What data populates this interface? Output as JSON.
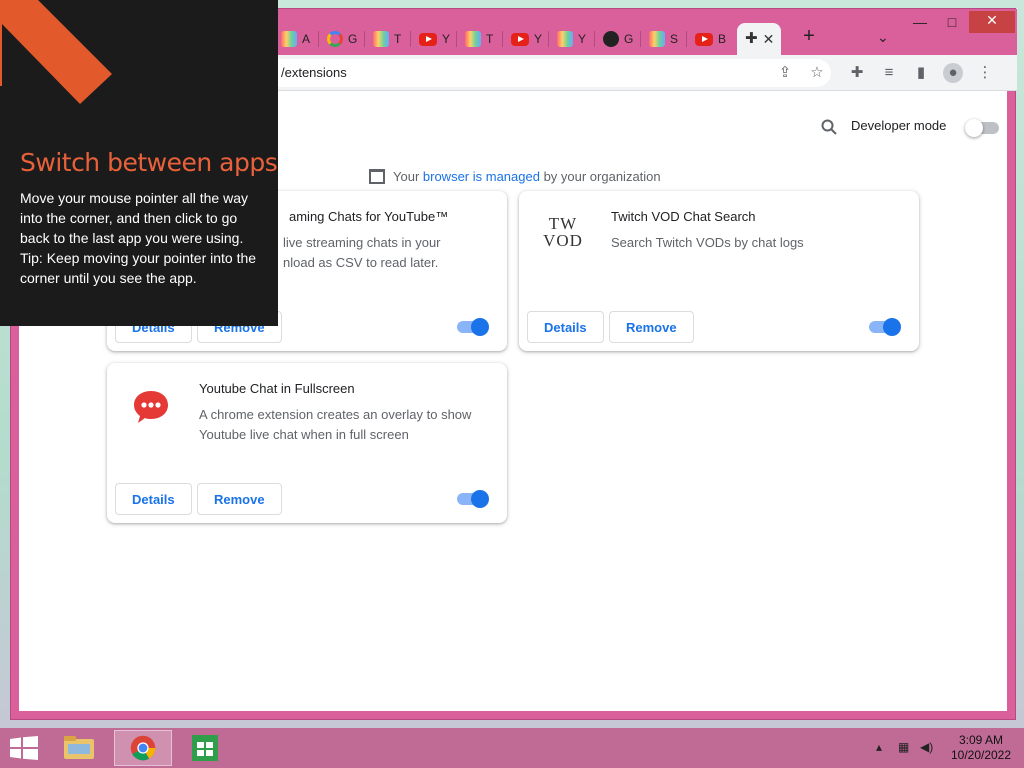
{
  "browser": {
    "tabs": [
      {
        "label": "A",
        "icon": "rainbow-favicon"
      },
      {
        "label": "G",
        "icon": "google-favicon"
      },
      {
        "label": "T",
        "icon": "rainbow-favicon"
      },
      {
        "label": "Y",
        "icon": "youtube-favicon"
      },
      {
        "label": "T",
        "icon": "rainbow-favicon"
      },
      {
        "label": "Y",
        "icon": "youtube-favicon"
      },
      {
        "label": "Y",
        "icon": "rainbow-favicon"
      },
      {
        "label": "G",
        "icon": "github-favicon"
      },
      {
        "label": "S",
        "icon": "rainbow-favicon"
      },
      {
        "label": "B",
        "icon": "youtube-favicon"
      }
    ],
    "active_tab_icon": "puzzle-icon",
    "address": "/extensions",
    "window_controls": {
      "minimize": "—",
      "maximize": "□",
      "close": "✕"
    }
  },
  "extensions_page": {
    "developer_mode_label": "Developer mode",
    "developer_mode_on": false,
    "managed_prefix": "Your ",
    "managed_link": "browser is managed",
    "managed_suffix": " by your organization",
    "cards": [
      {
        "title": "aming Chats for YouTube™",
        "desc": "live streaming chats in your\nnload as CSV to read later.",
        "details": "Details",
        "remove": "Remove",
        "enabled": true
      },
      {
        "title": "Twitch VOD Chat Search",
        "desc": "Search Twitch VODs by chat logs",
        "icon_text_top": "TW",
        "icon_text_bottom": "VOD",
        "details": "Details",
        "remove": "Remove",
        "enabled": true
      },
      {
        "title": "Youtube Chat in Fullscreen",
        "desc": "A chrome extension creates an overlay to show Youtube live chat when in full screen",
        "details": "Details",
        "remove": "Remove",
        "enabled": true
      }
    ]
  },
  "tip": {
    "title": "Switch between apps",
    "body": "Move your mouse pointer all the way into the corner, and then click to go back to the last app you were using.",
    "tip_line": "Tip: Keep moving your pointer into the corner until you see the app."
  },
  "taskbar": {
    "time": "3:09 AM",
    "date": "10/20/2022"
  },
  "colors": {
    "accent": "#1a73e8",
    "tip_title": "#e8613a",
    "window_frame": "#d9609b"
  }
}
